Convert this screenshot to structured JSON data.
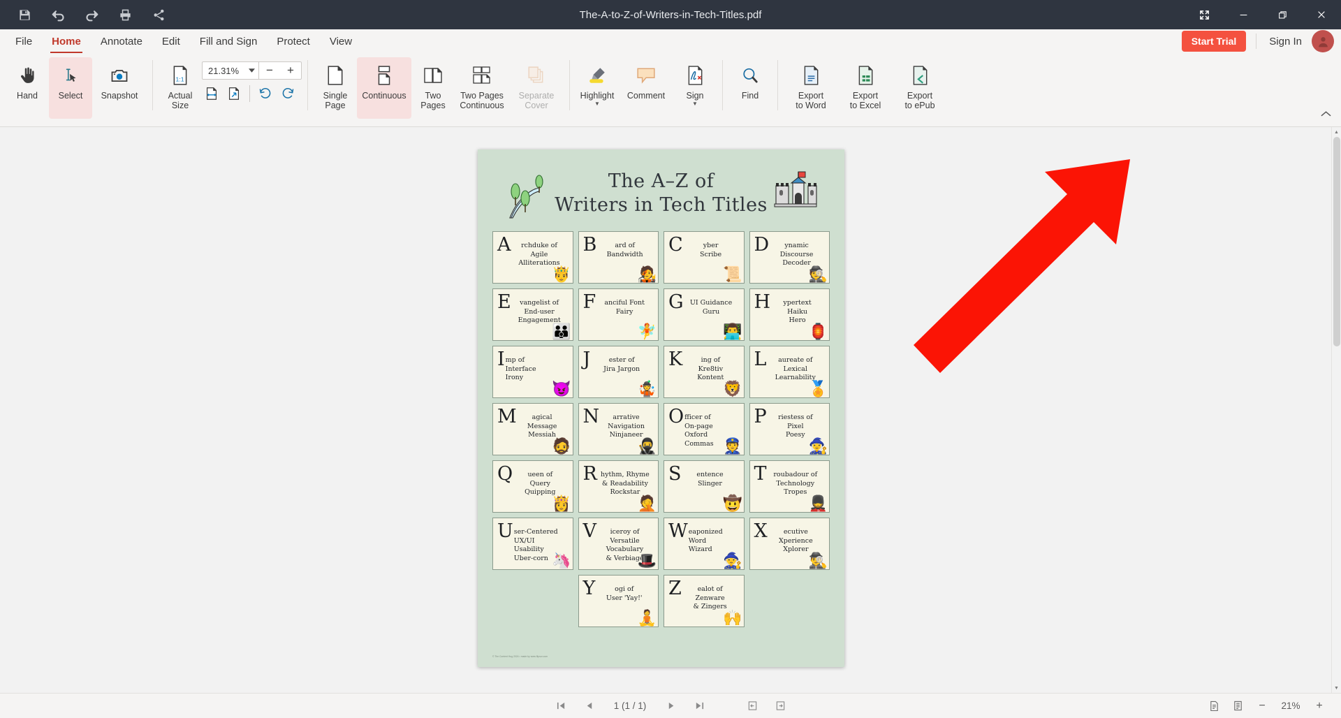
{
  "titlebar": {
    "document_title": "The-A-to-Z-of-Writers-in-Tech-Titles.pdf",
    "quick_tools": [
      {
        "name": "save-icon",
        "label": "Save"
      },
      {
        "name": "undo-icon",
        "label": "Undo"
      },
      {
        "name": "redo-icon",
        "label": "Redo"
      },
      {
        "name": "print-icon",
        "label": "Print"
      },
      {
        "name": "share-icon",
        "label": "Share"
      }
    ],
    "window_controls": [
      {
        "name": "fullscreen-icon",
        "label": "Full Screen"
      },
      {
        "name": "minimize-icon",
        "label": "Minimize"
      },
      {
        "name": "maximize-icon",
        "label": "Restore"
      },
      {
        "name": "close-icon",
        "label": "Close"
      }
    ]
  },
  "menubar": {
    "items": [
      {
        "label": "File",
        "active": false
      },
      {
        "label": "Home",
        "active": true
      },
      {
        "label": "Annotate",
        "active": false
      },
      {
        "label": "Edit",
        "active": false
      },
      {
        "label": "Fill and Sign",
        "active": false
      },
      {
        "label": "Protect",
        "active": false
      },
      {
        "label": "View",
        "active": false
      }
    ],
    "trial_label": "Start Trial",
    "signin_label": "Sign In",
    "accent_color": "#c0392b",
    "trial_color": "#f4513f"
  },
  "ribbon": {
    "tools": [
      {
        "label": "Hand",
        "icon": "hand-icon",
        "selected": false
      },
      {
        "label": "Select",
        "icon": "select-cursor-icon",
        "selected": true
      },
      {
        "label": "Snapshot",
        "icon": "camera-icon",
        "selected": false
      }
    ],
    "zoom": {
      "actual_size_label": "Actual\nSize",
      "actual_size_line1": "Actual",
      "actual_size_line2": "Size",
      "value": "21.31%",
      "minus_label": "−",
      "plus_label": "+",
      "fit_width_icon": "fit-width-icon",
      "fit_page_icon": "fit-page-icon",
      "rotate_left_icon": "rotate-left-icon",
      "rotate_right_icon": "rotate-right-icon"
    },
    "layouts": [
      {
        "label_1": "Single",
        "label_2": "Page",
        "icon": "single-page-icon",
        "selected": false
      },
      {
        "label_1": "Continuous",
        "label_2": "",
        "icon": "continuous-icon",
        "selected": true
      },
      {
        "label_1": "Two",
        "label_2": "Pages",
        "icon": "two-pages-icon",
        "selected": false
      },
      {
        "label_1": "Two Pages",
        "label_2": "Continuous",
        "icon": "two-pages-continuous-icon",
        "selected": false
      },
      {
        "label_1": "Separate",
        "label_2": "Cover",
        "icon": "separate-cover-icon",
        "selected": false,
        "disabled": true
      }
    ],
    "annotate": [
      {
        "label_1": "Highlight",
        "label_2": "",
        "icon": "highlighter-icon",
        "has_caret": true
      },
      {
        "label_1": "Comment",
        "label_2": "",
        "icon": "comment-bubble-icon",
        "has_caret": false
      },
      {
        "label_1": "Sign",
        "label_2": "",
        "icon": "signature-icon",
        "has_caret": true
      }
    ],
    "find": {
      "label": "Find",
      "icon": "magnifier-icon"
    },
    "exports": [
      {
        "label_1": "Export",
        "label_2": "to Word",
        "icon": "export-word-icon"
      },
      {
        "label_1": "Export",
        "label_2": "to Excel",
        "icon": "export-excel-icon"
      },
      {
        "label_1": "Export",
        "label_2": "to ePub",
        "icon": "export-epub-icon"
      }
    ],
    "collapse_icon": "chevron-up-icon"
  },
  "document": {
    "title_line_1": "The A–Z of",
    "title_line_2": "Writers in Tech Titles",
    "page_bg": "#cfdfd0",
    "card_bg": "#f7f5e6",
    "footer": "© The Content Hug 2024 • made by www.flipsor.com",
    "cards": [
      {
        "letter": "A",
        "lines": [
          "rchduke of",
          "Agile",
          "Alliterations"
        ],
        "emoji": "🤴",
        "align": "center"
      },
      {
        "letter": "B",
        "lines": [
          "ard of",
          "Bandwidth"
        ],
        "emoji": "🧑‍🎤",
        "align": "center"
      },
      {
        "letter": "C",
        "lines": [
          "yber",
          "Scribe"
        ],
        "emoji": "📜",
        "align": "center"
      },
      {
        "letter": "D",
        "lines": [
          "ynamic",
          "Discourse",
          "Decoder"
        ],
        "emoji": "🕵️",
        "align": "center"
      },
      {
        "letter": "E",
        "lines": [
          "vangelist of",
          "End-user",
          "Engagement"
        ],
        "emoji": "👪",
        "align": "center"
      },
      {
        "letter": "F",
        "lines": [
          "anciful Font",
          "Fairy"
        ],
        "emoji": "🧚",
        "align": "center"
      },
      {
        "letter": "G",
        "lines": [
          "UI Guidance",
          "Guru"
        ],
        "emoji": "👨‍💻",
        "align": "center"
      },
      {
        "letter": "H",
        "lines": [
          "ypertext",
          "Haiku",
          "Hero"
        ],
        "emoji": "🏮",
        "align": "center"
      },
      {
        "letter": "I",
        "lines": [
          "mp of",
          "Interface",
          "Irony"
        ],
        "emoji": "😈",
        "align": "left"
      },
      {
        "letter": "J",
        "lines": [
          "ester of",
          "Jira Jargon"
        ],
        "emoji": "🤹",
        "align": "center"
      },
      {
        "letter": "K",
        "lines": [
          "ing of",
          "Kre8tiv",
          "Kontent"
        ],
        "emoji": "🦁",
        "align": "center"
      },
      {
        "letter": "L",
        "lines": [
          "aureate of",
          "Lexical",
          "Learnability"
        ],
        "emoji": "🏅",
        "align": "center"
      },
      {
        "letter": "M",
        "lines": [
          "agical",
          "Message",
          "Messiah"
        ],
        "emoji": "🧔",
        "align": "center"
      },
      {
        "letter": "N",
        "lines": [
          "arrative",
          "Navigation",
          "Ninjaneer"
        ],
        "emoji": "🥷",
        "align": "center"
      },
      {
        "letter": "O",
        "lines": [
          "fficer of",
          "On-page",
          "Oxford",
          "Commas"
        ],
        "emoji": "👮",
        "align": "center"
      },
      {
        "letter": "P",
        "lines": [
          "riestess of",
          "Pixel",
          "Poesy"
        ],
        "emoji": "🧙‍♀️",
        "align": "center"
      },
      {
        "letter": "Q",
        "lines": [
          "ueen of",
          "Query",
          "Quipping"
        ],
        "emoji": "👸",
        "align": "center"
      },
      {
        "letter": "R",
        "lines": [
          "hythm, Rhyme",
          "& Readability",
          "Rockstar"
        ],
        "emoji": "🤦",
        "align": "center"
      },
      {
        "letter": "S",
        "lines": [
          "entence",
          "Slinger"
        ],
        "emoji": "🤠",
        "align": "center"
      },
      {
        "letter": "T",
        "lines": [
          "roubadour of",
          "Technology",
          "Tropes"
        ],
        "emoji": "💂",
        "align": "center"
      },
      {
        "letter": "U",
        "lines": [
          "ser-Centered",
          "UX/UI",
          "Usability",
          "Uber-corn"
        ],
        "emoji": "🦄",
        "align": "left"
      },
      {
        "letter": "V",
        "lines": [
          "iceroy of Versatile",
          "Vocabulary",
          "& Verbiage"
        ],
        "emoji": "🎩",
        "align": "center"
      },
      {
        "letter": "W",
        "lines": [
          "eaponized",
          "Word",
          "Wizard"
        ],
        "emoji": "🧙",
        "align": "left"
      },
      {
        "letter": "X",
        "lines": [
          "ecutive",
          "Xperience",
          "Xplorer"
        ],
        "emoji": "🕵️‍♂️",
        "align": "center"
      },
      {
        "letter": "Y",
        "lines": [
          "ogi of",
          "User 'Yay!'"
        ],
        "emoji": "🧘",
        "align": "center"
      },
      {
        "letter": "Z",
        "lines": [
          "ealot of",
          "Zenware",
          "& Zingers"
        ],
        "emoji": "🙌",
        "align": "center"
      }
    ]
  },
  "statusbar": {
    "first_page_icon": "first-page-icon",
    "prev_page_icon": "previous-page-icon",
    "page_indicator": "1 (1 / 1)",
    "next_page_icon": "next-page-icon",
    "last_page_icon": "last-page-icon",
    "prev_view_icon": "previous-view-icon",
    "next_view_icon": "next-view-icon",
    "single_page_view_icon": "single-page-view-icon",
    "continuous_view_icon": "continuous-view-icon",
    "zoom_out_label": "−",
    "zoom_level": "21%",
    "zoom_in_label": "+"
  }
}
